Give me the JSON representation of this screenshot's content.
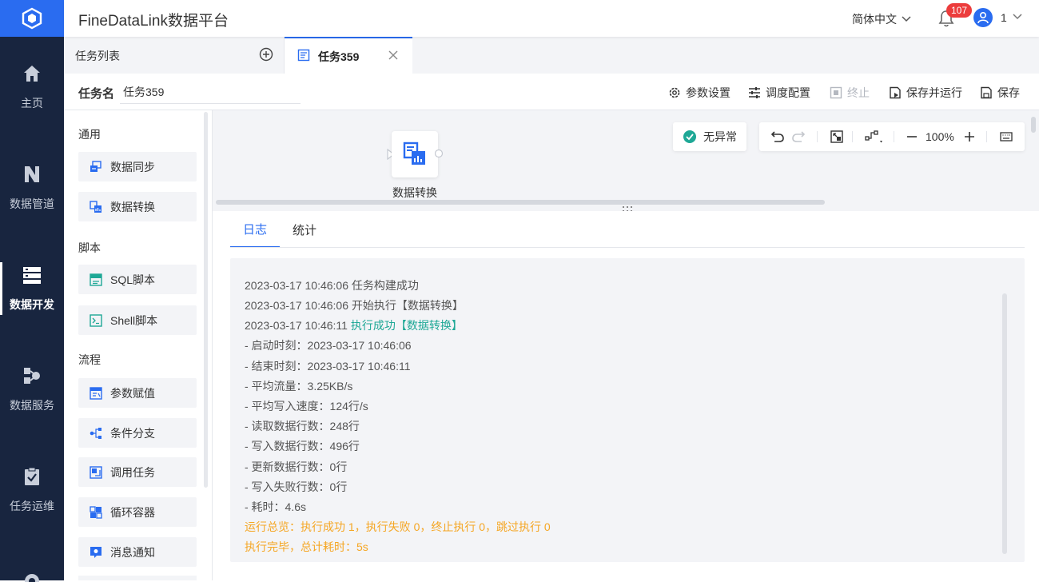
{
  "app": {
    "title": "FineDataLink数据平台"
  },
  "header": {
    "language": "简体中文",
    "notification_count": "107",
    "user": "1"
  },
  "sidebar": {
    "items": [
      {
        "label": "主页",
        "icon": "home-icon"
      },
      {
        "label": "数据管道",
        "icon": "pipeline-icon"
      },
      {
        "label": "数据开发",
        "icon": "dev-icon",
        "active": true
      },
      {
        "label": "数据服务",
        "icon": "service-icon"
      },
      {
        "label": "任务运维",
        "icon": "ops-icon"
      }
    ]
  },
  "tabs": {
    "list_label": "任务列表",
    "task_tab_label": "任务359"
  },
  "task": {
    "name_label": "任务名",
    "name_value": "任务359",
    "actions": {
      "params": "参数设置",
      "schedule": "调度配置",
      "stop": "终止",
      "save_run": "保存并运行",
      "save": "保存"
    }
  },
  "palette": {
    "sections": [
      {
        "title": "通用",
        "items": [
          "数据同步",
          "数据转换"
        ]
      },
      {
        "title": "脚本",
        "items": [
          "SQL脚本",
          "Shell脚本"
        ]
      },
      {
        "title": "流程",
        "items": [
          "参数赋值",
          "条件分支",
          "调用任务",
          "循环容器",
          "消息通知"
        ]
      }
    ]
  },
  "canvas": {
    "node_label": "数据转换",
    "status": "无异常",
    "zoom": "100%"
  },
  "log": {
    "tabs": [
      "日志",
      "统计"
    ],
    "lines": [
      {
        "prefix": "2023-03-17 10:46:06 ",
        "text": "任务构建成功",
        "style": "normal"
      },
      {
        "prefix": "2023-03-17 10:46:06 ",
        "text": "开始执行【数据转换】",
        "style": "normal"
      },
      {
        "prefix": "2023-03-17 10:46:11 ",
        "text": "执行成功【数据转换】",
        "style": "success"
      },
      {
        "prefix": "",
        "text": "- 启动时刻：2023-03-17 10:46:06",
        "style": "normal"
      },
      {
        "prefix": "",
        "text": "- 结束时刻：2023-03-17 10:46:11",
        "style": "normal"
      },
      {
        "prefix": "",
        "text": "- 平均流量：3.25KB/s",
        "style": "normal"
      },
      {
        "prefix": "",
        "text": "- 平均写入速度：124行/s",
        "style": "normal"
      },
      {
        "prefix": "",
        "text": "- 读取数据行数：248行",
        "style": "normal"
      },
      {
        "prefix": "",
        "text": "- 写入数据行数：496行",
        "style": "normal"
      },
      {
        "prefix": "",
        "text": "- 更新数据行数：0行",
        "style": "normal"
      },
      {
        "prefix": "",
        "text": "- 写入失败行数：0行",
        "style": "normal"
      },
      {
        "prefix": "",
        "text": "- 耗时：4.6s",
        "style": "normal"
      },
      {
        "prefix": "",
        "text": "运行总览：执行成功 1，执行失败 0，终止执行 0，跳过执行 0",
        "style": "warn"
      },
      {
        "prefix": "",
        "text": "执行完毕，总计耗时：5s",
        "style": "warn"
      }
    ]
  },
  "colors": {
    "accent": "#2a6cf0",
    "sidebar_bg": "#18253f",
    "success": "#1ea896",
    "warn": "#f5a623"
  }
}
